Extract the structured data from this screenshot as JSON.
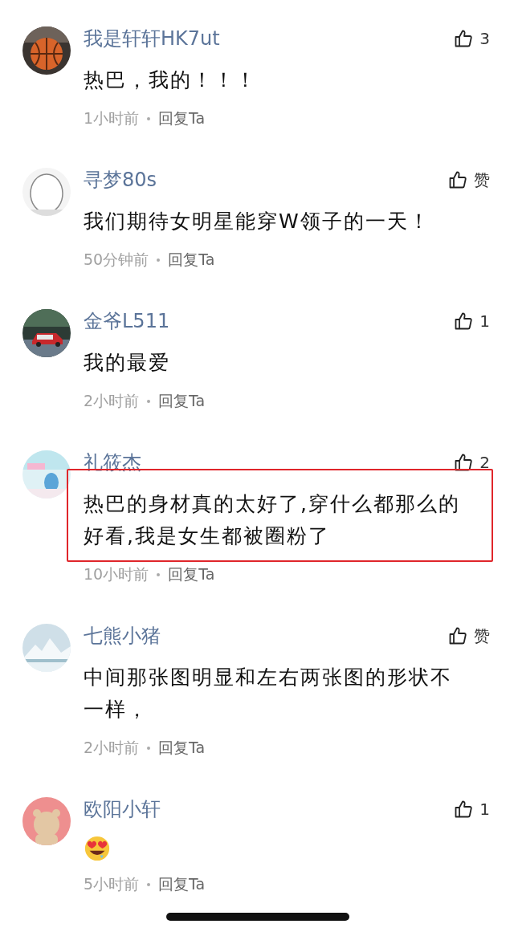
{
  "comments": [
    {
      "user": "我是轩轩HK7ut",
      "likes": "3",
      "kind": "text",
      "body": "热巴，我的！！！",
      "time": "1小时前",
      "reply": "回复Ta",
      "highlighted": false
    },
    {
      "user": "寻梦80s",
      "likes": "赞",
      "kind": "text",
      "body": "我们期待女明星能穿W领子的一天！",
      "time": "50分钟前",
      "reply": "回复Ta",
      "highlighted": false
    },
    {
      "user": "金爷L511",
      "likes": "1",
      "kind": "text",
      "body": "我的最爱",
      "time": "2小时前",
      "reply": "回复Ta",
      "highlighted": false
    },
    {
      "user": "礼筱杰",
      "likes": "2",
      "kind": "text",
      "body": "热巴的身材真的太好了,穿什么都那么的好看,我是女生都被圈粉了",
      "time": "10小时前",
      "reply": "回复Ta",
      "highlighted": true
    },
    {
      "user": "七熊小猪",
      "likes": "赞",
      "kind": "text",
      "body": "中间那张图明显和左右两张图的形状不一样，",
      "time": "2小时前",
      "reply": "回复Ta",
      "highlighted": false
    },
    {
      "user": "欧阳小轩",
      "likes": "1",
      "kind": "emoji",
      "time": "5小时前",
      "reply": "回复Ta",
      "highlighted": false
    }
  ]
}
